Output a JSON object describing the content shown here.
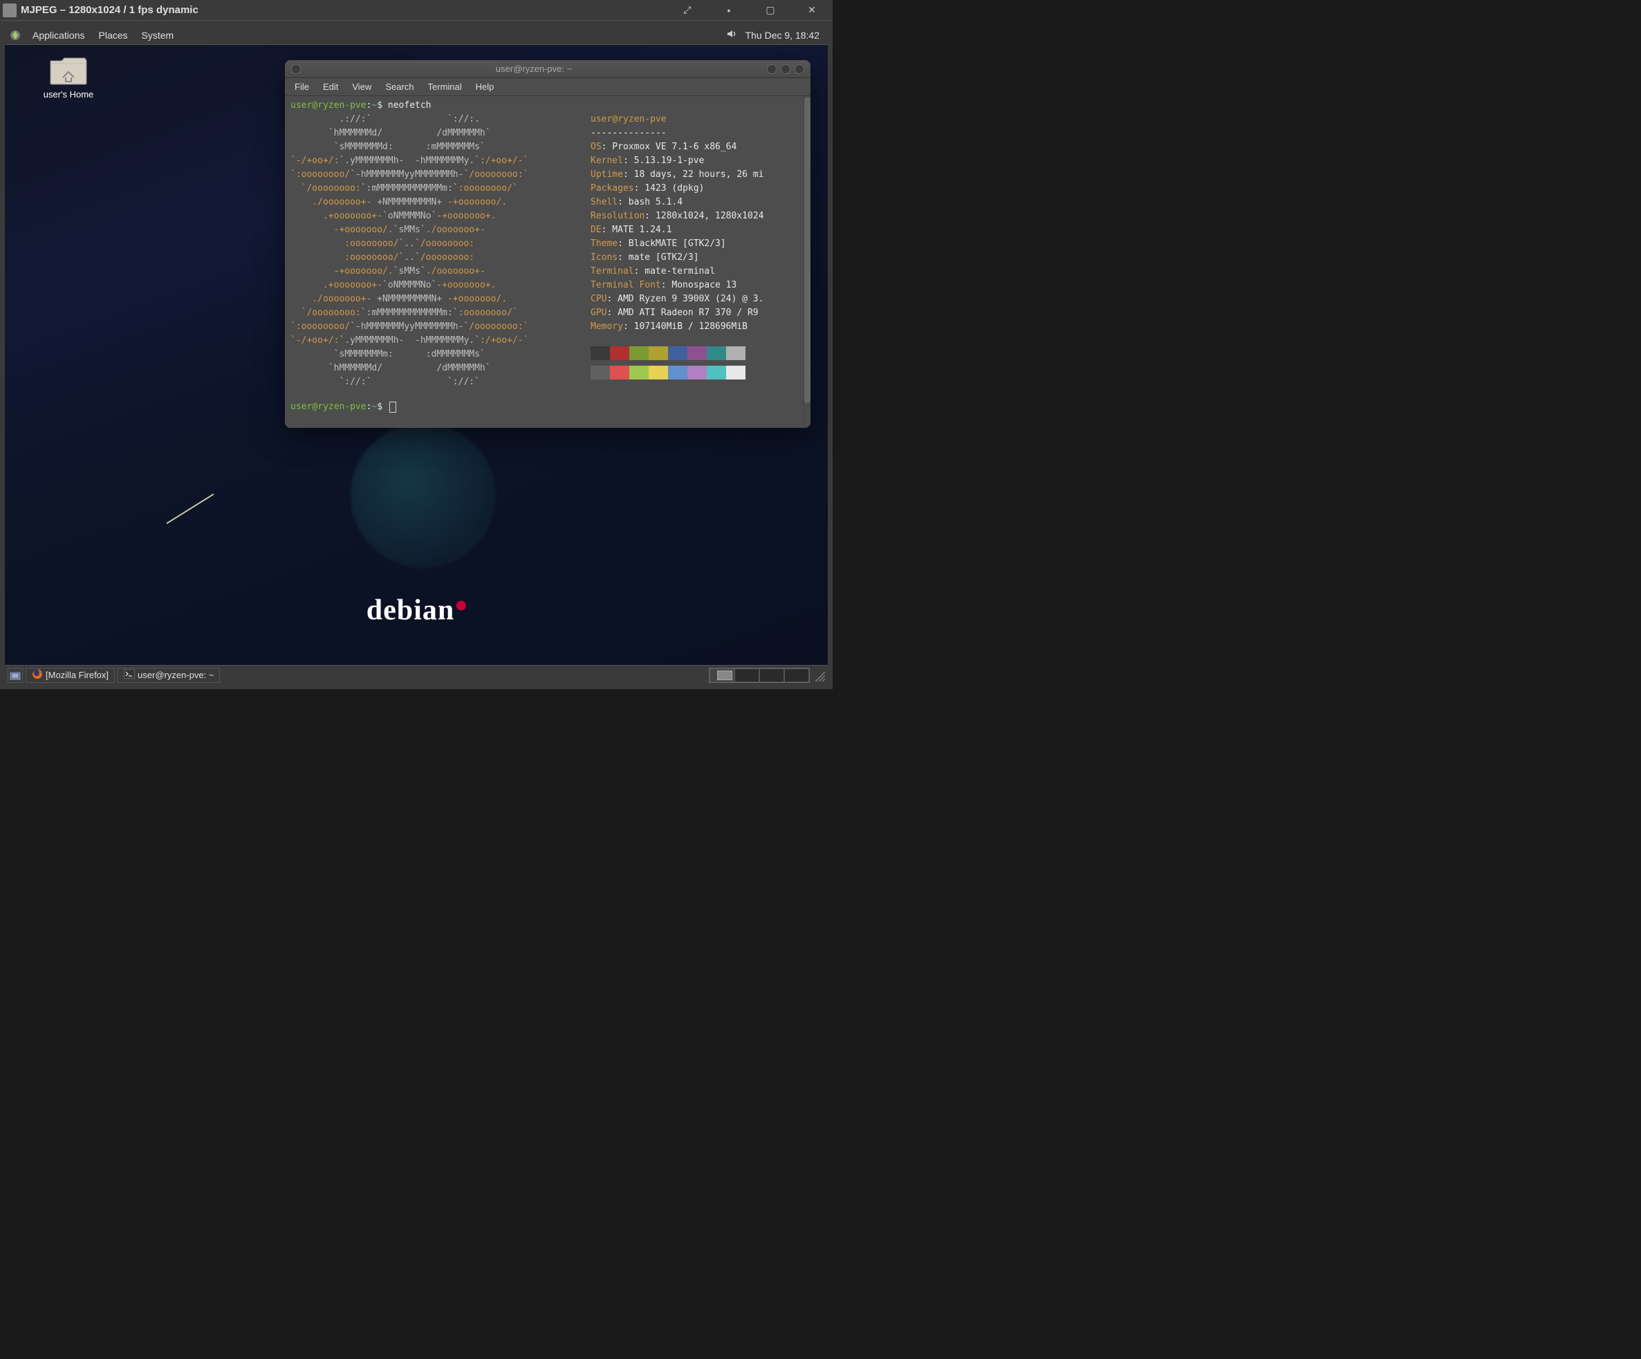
{
  "outer": {
    "title": "MJPEG – 1280x1024 / 1 fps dynamic"
  },
  "top_panel": {
    "menus": [
      "Applications",
      "Places",
      "System"
    ],
    "clock": "Thu Dec  9, 18:42"
  },
  "desktop": {
    "home_icon_label": "user's Home",
    "debian_text": "debian"
  },
  "bottom_panel": {
    "tasks": [
      {
        "label": "[Mozilla Firefox]",
        "icon": "firefox"
      },
      {
        "label": "user@ryzen-pve: ~",
        "icon": "terminal"
      }
    ]
  },
  "terminal": {
    "title": "user@ryzen-pve: ~",
    "menus": [
      "File",
      "Edit",
      "View",
      "Search",
      "Terminal",
      "Help"
    ],
    "prompt_user": "user@ryzen-pve",
    "prompt_sep": ":",
    "prompt_path": "~",
    "prompt_dollar": "$",
    "command": "neofetch",
    "info": {
      "user_host": "user@ryzen-pve",
      "separator": "--------------",
      "OS": "Proxmox VE 7.1-6 x86_64",
      "Kernel": "5.13.19-1-pve",
      "Uptime": "18 days, 22 hours, 26 mi",
      "Packages": "1423 (dpkg)",
      "Shell": "bash 5.1.4",
      "Resolution": "1280x1024, 1280x1024",
      "DE": "MATE 1.24.1",
      "Theme": "BlackMATE [GTK2/3]",
      "Icons": "mate [GTK2/3]",
      "Terminal": "mate-terminal",
      "Terminal_Font": "Monospace 13",
      "CPU": "AMD Ryzen 9 3900X (24) @ 3.",
      "GPU": "AMD ATI Radeon R7 370 / R9",
      "Memory": "107140MiB / 128696MiB"
    },
    "swatches": [
      [
        "#3a3a3a",
        "#b03030",
        "#7a9a30",
        "#b0a030",
        "#4060a0",
        "#905090",
        "#308a8a",
        "#b0b0b0"
      ],
      [
        "#606060",
        "#e05050",
        "#9ec850",
        "#e8d050",
        "#6090d0",
        "#b080c0",
        "#50c0c0",
        "#e8e8e8"
      ]
    ],
    "ascii_art": [
      [
        [
          "g",
          "         .://:`              `://:."
        ]
      ],
      [
        [
          "g",
          "       `hMMMMMMd/          /dMMMMMMh`"
        ]
      ],
      [
        [
          "g",
          "        `sMMMMMMMd:      :mMMMMMMMs`"
        ]
      ],
      [
        [
          "o",
          "`-/+oo+/:"
        ],
        [
          "g",
          "`.yMMMMMMMh-  -hMMMMMMMy.`"
        ],
        [
          "o",
          ":/+oo+/-`"
        ]
      ],
      [
        [
          "o",
          "`:oooooooo/"
        ],
        [
          "g",
          "`-hMMMMMMMyyMMMMMMMh-`"
        ],
        [
          "o",
          "/oooooooo:`"
        ]
      ],
      [
        [
          "o",
          "  `/oooooooo:"
        ],
        [
          "g",
          "`:mMMMMMMMMMMMMm:`"
        ],
        [
          "o",
          ":oooooooo/`"
        ]
      ],
      [
        [
          "o",
          "    ./ooooooo+-"
        ],
        [
          "g",
          " +NMMMMMMMMN+ "
        ],
        [
          "o",
          "-+ooooooo/."
        ]
      ],
      [
        [
          "o",
          "      .+ooooooo+-"
        ],
        [
          "g",
          "`oNMMMMNo`"
        ],
        [
          "o",
          "-+ooooooo+."
        ]
      ],
      [
        [
          "o",
          "        -+ooooooo/."
        ],
        [
          "g",
          "`sMMs`"
        ],
        [
          "o",
          "./ooooooo+-"
        ]
      ],
      [
        [
          "o",
          "          :oooooooo/"
        ],
        [
          "g",
          "`..`"
        ],
        [
          "o",
          "/oooooooo:"
        ]
      ],
      [
        [
          "o",
          "          :oooooooo/"
        ],
        [
          "g",
          "`..`"
        ],
        [
          "o",
          "/oooooooo:"
        ]
      ],
      [
        [
          "o",
          "        -+ooooooo/."
        ],
        [
          "g",
          "`sMMs`"
        ],
        [
          "o",
          "./ooooooo+-"
        ]
      ],
      [
        [
          "o",
          "      .+ooooooo+-"
        ],
        [
          "g",
          "`oNMMMMNo`"
        ],
        [
          "o",
          "-+ooooooo+."
        ]
      ],
      [
        [
          "o",
          "    ./ooooooo+-"
        ],
        [
          "g",
          " +NMMMMMMMMN+ "
        ],
        [
          "o",
          "-+ooooooo/."
        ]
      ],
      [
        [
          "o",
          "  `/oooooooo:"
        ],
        [
          "g",
          "`:mMMMMMMMMMMMMm:`"
        ],
        [
          "o",
          ":oooooooo/`"
        ]
      ],
      [
        [
          "o",
          "`:oooooooo/"
        ],
        [
          "g",
          "`-hMMMMMMMyyMMMMMMMh-`"
        ],
        [
          "o",
          "/oooooooo:`"
        ]
      ],
      [
        [
          "o",
          "`-/+oo+/:"
        ],
        [
          "g",
          "`.yMMMMMMMh-  -hMMMMMMMy.`"
        ],
        [
          "o",
          ":/+oo+/-`"
        ]
      ],
      [
        [
          "g",
          "        `sMMMMMMMm:      :dMMMMMMMs`"
        ]
      ],
      [
        [
          "g",
          "       `hMMMMMMd/          /dMMMMMMh`"
        ]
      ],
      [
        [
          "g",
          "         `://:`              `://:`"
        ]
      ]
    ]
  }
}
